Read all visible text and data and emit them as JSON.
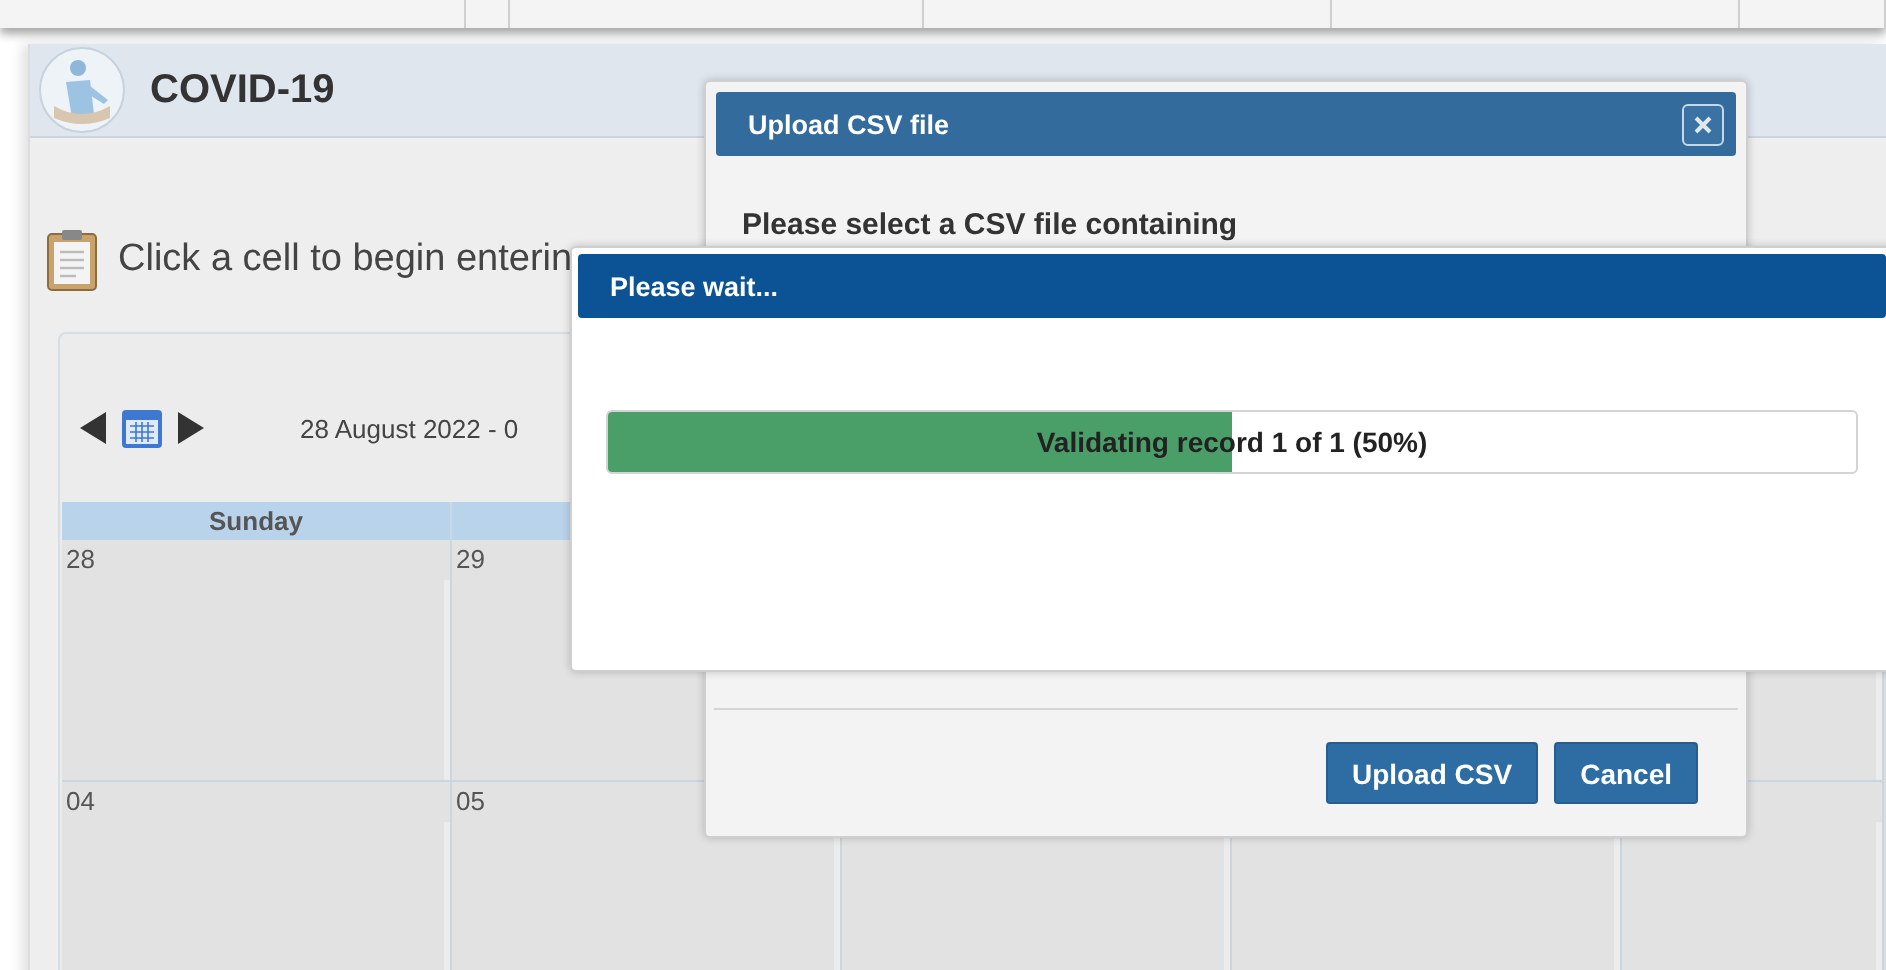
{
  "app": {
    "title": "COVID-19"
  },
  "instruction": "Click a cell to begin enterin",
  "calendar": {
    "range": "28 August 2022 - 0",
    "day_headers": [
      "Sunday"
    ],
    "weeks": [
      [
        "28",
        "29"
      ],
      [
        "04",
        "05"
      ]
    ]
  },
  "upload_dialog": {
    "title": "Upload CSV file",
    "message": "Please select a CSV file containing",
    "buttons": [
      "Upload CSV",
      "Cancel"
    ]
  },
  "wait_dialog": {
    "title": "Please wait...",
    "progress": {
      "level": 0.5,
      "label": "Validating record 1 of 1 (50%)"
    }
  }
}
